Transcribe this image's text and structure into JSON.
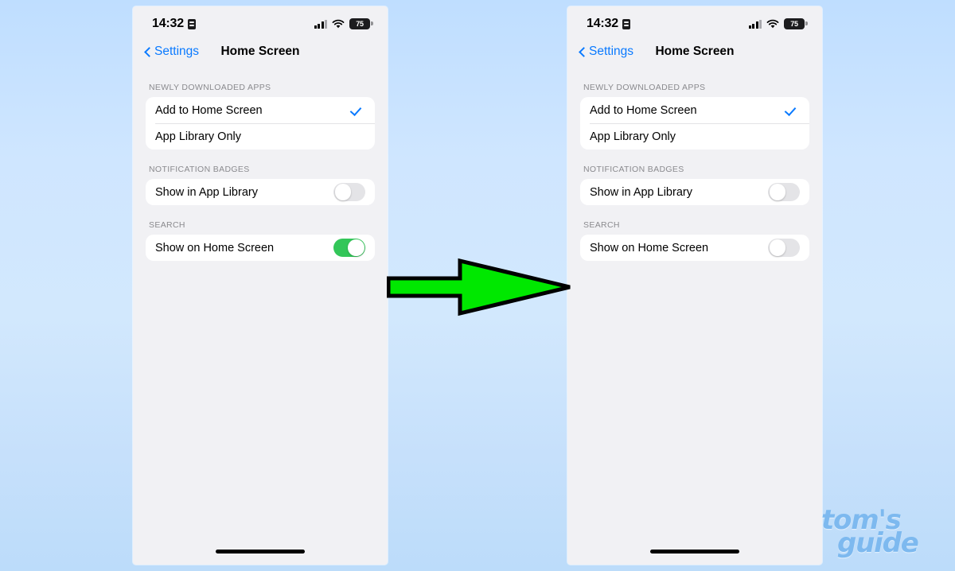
{
  "background": {
    "color_top": "#bfdeff",
    "color_bottom": "#bcdcfa"
  },
  "arrow": {
    "name": "green-right-arrow",
    "fill": "#00e800",
    "stroke": "#000000"
  },
  "watermark": {
    "line1": "tom's",
    "line2": "guide",
    "color": "#7db9ef"
  },
  "phones": [
    {
      "id": "before",
      "status_bar": {
        "time": "14:32",
        "record_icon": "screen-record-icon",
        "signal_icon": "cellular-signal-icon",
        "wifi_icon": "wifi-icon",
        "battery_level": "75"
      },
      "nav": {
        "back_label": "Settings",
        "back_icon": "chevron-left-icon",
        "title": "Home Screen"
      },
      "sections": [
        {
          "header": "NEWLY DOWNLOADED APPS",
          "rows": [
            {
              "label": "Add to Home Screen",
              "control": "check",
              "checked": true
            },
            {
              "label": "App Library Only",
              "control": "none",
              "checked": false
            }
          ]
        },
        {
          "header": "NOTIFICATION BADGES",
          "rows": [
            {
              "label": "Show in App Library",
              "control": "toggle",
              "on": false
            }
          ]
        },
        {
          "header": "SEARCH",
          "rows": [
            {
              "label": "Show on Home Screen",
              "control": "toggle",
              "on": true
            }
          ]
        }
      ]
    },
    {
      "id": "after",
      "status_bar": {
        "time": "14:32",
        "record_icon": "screen-record-icon",
        "signal_icon": "cellular-signal-icon",
        "wifi_icon": "wifi-icon",
        "battery_level": "75"
      },
      "nav": {
        "back_label": "Settings",
        "back_icon": "chevron-left-icon",
        "title": "Home Screen"
      },
      "sections": [
        {
          "header": "NEWLY DOWNLOADED APPS",
          "rows": [
            {
              "label": "Add to Home Screen",
              "control": "check",
              "checked": true
            },
            {
              "label": "App Library Only",
              "control": "none",
              "checked": false
            }
          ]
        },
        {
          "header": "NOTIFICATION BADGES",
          "rows": [
            {
              "label": "Show in App Library",
              "control": "toggle",
              "on": false
            }
          ]
        },
        {
          "header": "SEARCH",
          "rows": [
            {
              "label": "Show on Home Screen",
              "control": "toggle",
              "on": false
            }
          ]
        }
      ]
    }
  ]
}
